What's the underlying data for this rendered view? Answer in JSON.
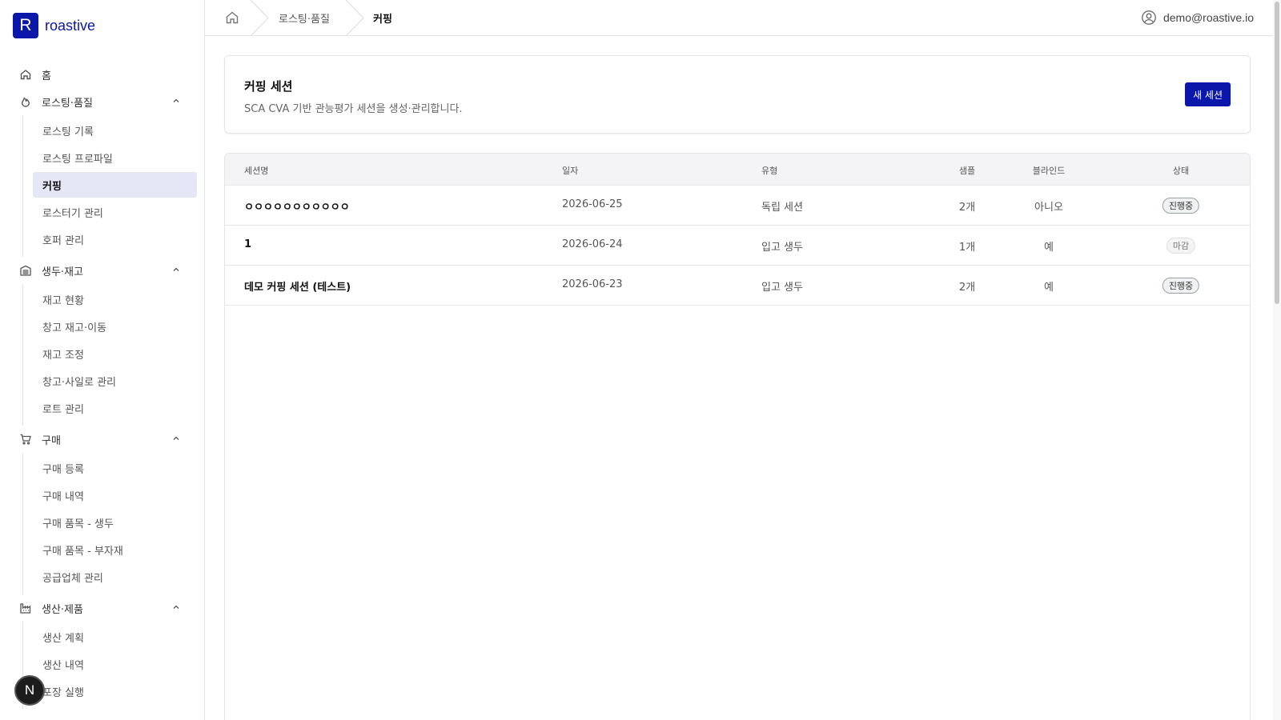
{
  "brand": {
    "logo_letter": "R",
    "name": "roastive",
    "color": "#0a17a8"
  },
  "sidebar": {
    "home": "홈",
    "groups": [
      {
        "label": "로스팅·품질",
        "icon": "flame-icon",
        "items": [
          "로스팅 기록",
          "로스팅 프로파일",
          "커핑",
          "로스터기 관리",
          "호퍼 관리"
        ]
      },
      {
        "label": "생두·재고",
        "icon": "warehouse-icon",
        "items": [
          "재고 현황",
          "창고 재고·이동",
          "재고 조정",
          "창고·사일로 관리",
          "로트 관리"
        ]
      },
      {
        "label": "구매",
        "icon": "cart-icon",
        "items": [
          "구매 등록",
          "구매 내역",
          "구매 품목 - 생두",
          "구매 품목 - 부자재",
          "공급업체 관리"
        ]
      },
      {
        "label": "생산·제품",
        "icon": "factory-icon",
        "items": [
          "생산 계획",
          "생산 내역",
          "포장 실행"
        ]
      }
    ],
    "active_item": "커핑"
  },
  "fab": {
    "letter": "N"
  },
  "breadcrumb": {
    "section": "로스팅·품질",
    "current": "커핑"
  },
  "user": {
    "email": "demo@roastive.io"
  },
  "header": {
    "title": "커핑 세션",
    "description": "SCA CVA 기반 관능평가 세션을 생성·관리합니다.",
    "new_button": "새 세션"
  },
  "table": {
    "columns": [
      "세션명",
      "일자",
      "유형",
      "샘플",
      "블라인드",
      "상태"
    ],
    "rows": [
      {
        "name": "ㅇㅇㅇㅇㅇㅇㅇㅇㅇㅇㅇ",
        "date": "2026-06-25",
        "type": "독립 세션",
        "samples": "2개",
        "blind": "아니오",
        "status": "진행중",
        "status_kind": "ongoing"
      },
      {
        "name": "1",
        "date": "2026-06-24",
        "type": "입고 생두",
        "samples": "1개",
        "blind": "예",
        "status": "마감",
        "status_kind": "closed"
      },
      {
        "name": "데모 커핑 세션 (테스트)",
        "date": "2026-06-23",
        "type": "입고 생두",
        "samples": "2개",
        "blind": "예",
        "status": "진행중",
        "status_kind": "ongoing"
      }
    ]
  }
}
